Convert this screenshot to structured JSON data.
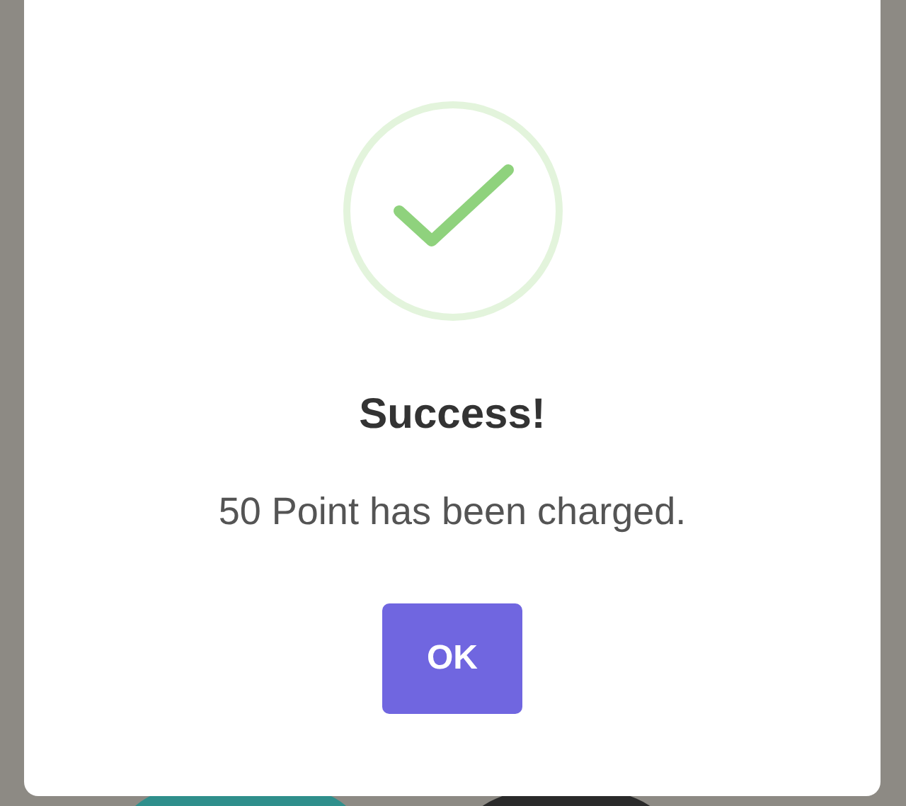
{
  "dialog": {
    "title": "Success!",
    "message": "50 Point has been charged.",
    "buttons": [
      "OK"
    ]
  }
}
